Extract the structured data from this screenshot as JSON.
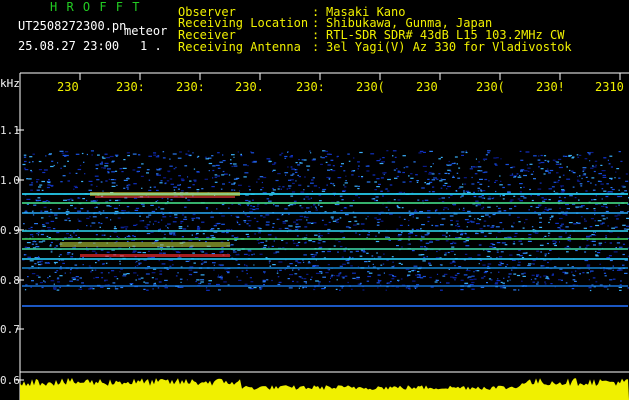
{
  "header": {
    "logo": "H R O F F T",
    "filename": "UT2508272300.pn",
    "suffix": "meteor",
    "datetime": "25.08.27 23:00",
    "counter": "1 .",
    "rows": [
      {
        "label": "Observer",
        "value": "Masaki Kano"
      },
      {
        "label": "Receiving Location",
        "value": "Shibukawa, Gunma, Japan"
      },
      {
        "label": "Receiver",
        "value": "RTL-SDR SDR# 43dB L15 103.2MHz CW"
      },
      {
        "label": "Receiving Antenna",
        "value": "3el Yagi(V) Az 330 for Vladivostok"
      }
    ]
  },
  "axis": {
    "unit": "kHz",
    "y_ticks": [
      "1.1",
      "1.0",
      "0.9",
      "0.8",
      "0.7",
      "0.6"
    ],
    "x_ticks": [
      "230",
      "230:",
      "230:",
      "230.",
      "230:",
      "230(",
      "230",
      "230(",
      "230!",
      "2310"
    ]
  }
}
